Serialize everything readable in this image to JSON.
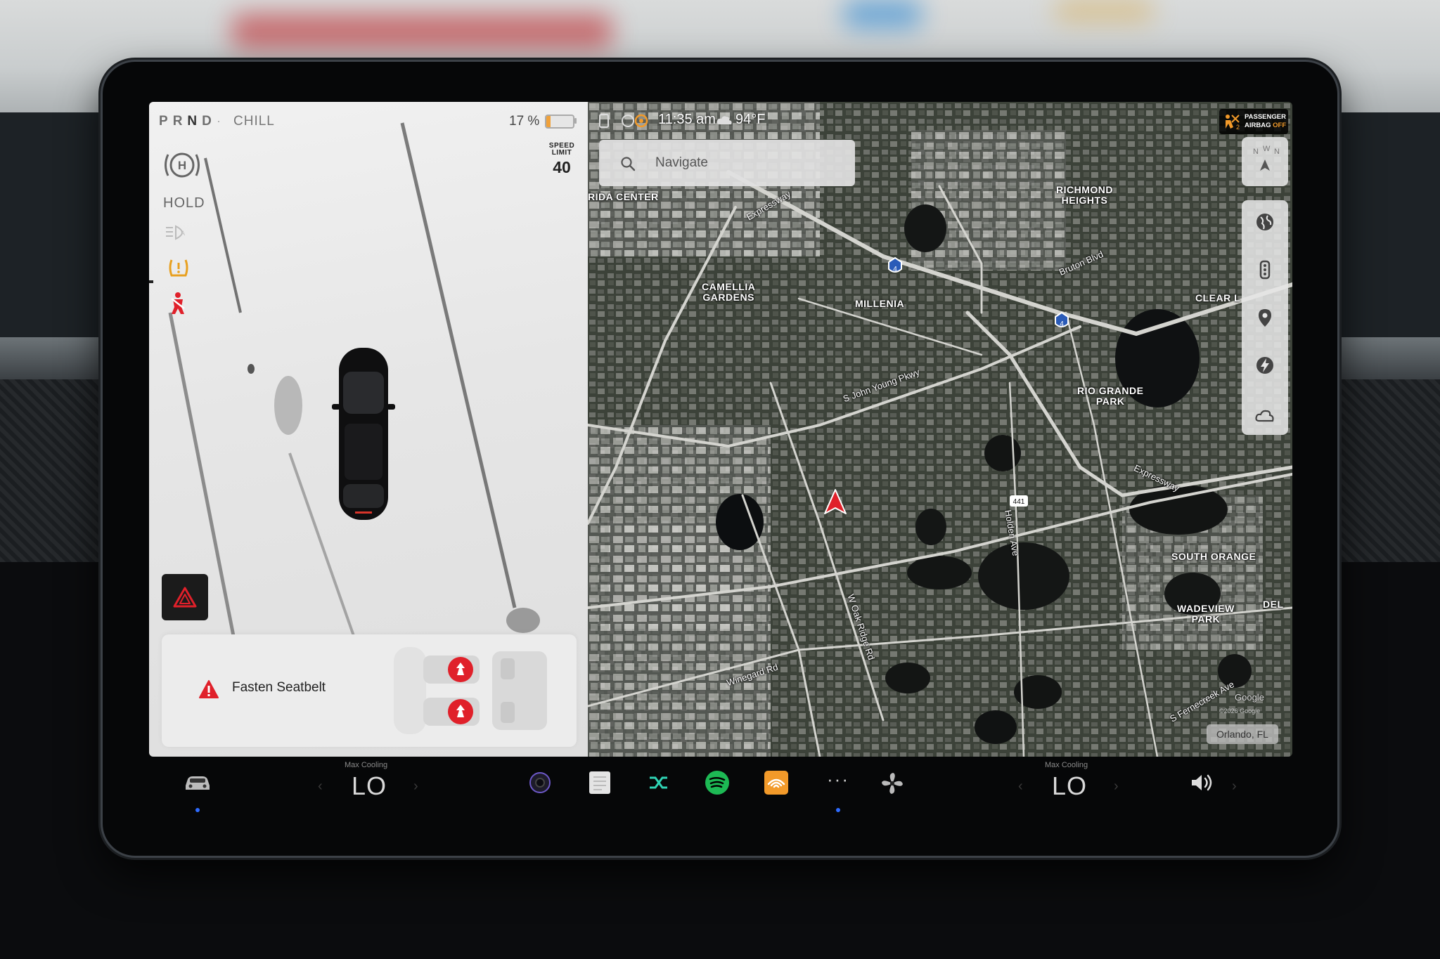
{
  "car_panel": {
    "gears": [
      "P",
      "R",
      "N",
      "D"
    ],
    "selected_gear": "N",
    "drive_mode": "CHILL",
    "battery_percent": "17 %",
    "battery_level": 0.17,
    "speed_limit": {
      "label_top": "SPEED",
      "label_bottom": "LIMIT",
      "value": "40"
    },
    "hold_label": "HOLD",
    "alert": {
      "text": "Fasten Seatbelt"
    }
  },
  "status_bar": {
    "time": "11:35 am",
    "temperature": "94°F",
    "airbag": {
      "line1": "PASSENGER",
      "line2_prefix": "AIRBAG",
      "line2_status": "OFF"
    }
  },
  "map": {
    "search_placeholder": "Navigate",
    "places": [
      "RIDA CENTER",
      "CAMELLIA\nGARDENS",
      "MILLENIA",
      "RICHMOND\nHEIGHTS",
      "RIO GRANDE\nPARK",
      "CLEAR L",
      "SOUTH ORANGE",
      "WADEVIEW\nPARK",
      "DEL"
    ],
    "roads": [
      "Expressway",
      "Bruton Blvd",
      "S John Young Pkwy",
      "Holden Ave",
      "W Oak Ridge Rd",
      "Winegard Rd",
      "S Fernecreek Ave",
      "Expressway"
    ],
    "shields": [
      "4",
      "4",
      "441"
    ],
    "attribution": "Google",
    "copyright": "©2026 Google",
    "location": "Orlando, FL"
  },
  "dock": {
    "left_climate": {
      "caption": "Max Cooling",
      "value": "LO"
    },
    "right_climate": {
      "caption": "Max Cooling",
      "value": "LO"
    },
    "apps": [
      "car-icon",
      "camera-icon",
      "notes-icon",
      "shuffle-icon",
      "spotify-icon",
      "audible-icon",
      "more-icon",
      "fan-icon"
    ],
    "volume_icon": "volume-icon"
  },
  "colors": {
    "alert_red": "#e0202a",
    "spotify_green": "#1db954",
    "audible_orange": "#f29a2a",
    "accent_blue": "#2e6bff"
  }
}
